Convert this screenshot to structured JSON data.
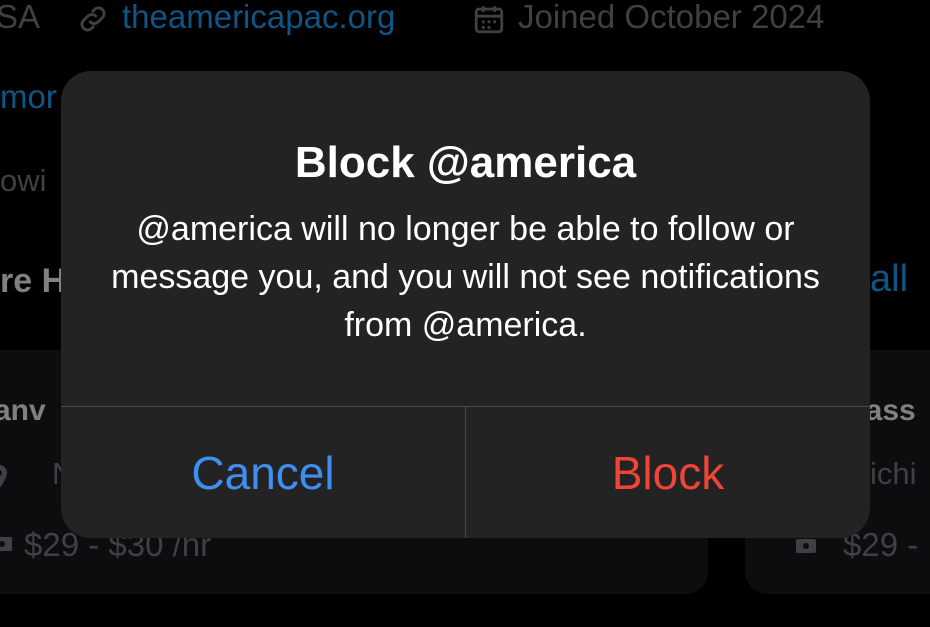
{
  "profile": {
    "location_fragment": "SA",
    "website": "theamericapac.org",
    "joined": "Joined October 2024",
    "more_fragment": "mor",
    "following_fragment": "owi",
    "section_fragment": "re H",
    "see_all_fragment": "all"
  },
  "job_cards": [
    {
      "title_fragment": "anv",
      "location_fragment": "No",
      "pay": "$29 - $30 /hr"
    },
    {
      "title_fragment": "vass",
      "location_fragment": "ichi",
      "pay": "$29 -"
    }
  ],
  "dialog": {
    "title": "Block @america",
    "message": "@america will no longer be able to follow or message you, and you will not see notifications from @america.",
    "cancel_label": "Cancel",
    "confirm_label": "Block"
  },
  "colors": {
    "link_blue": "#1d9bf0",
    "cancel_blue": "#3e8ff0",
    "destructive_red": "#f04437",
    "dialog_bg": "#232324"
  },
  "icons": {
    "link": "link-icon",
    "calendar": "calendar-icon",
    "location": "location-pin-icon",
    "money": "money-icon"
  }
}
